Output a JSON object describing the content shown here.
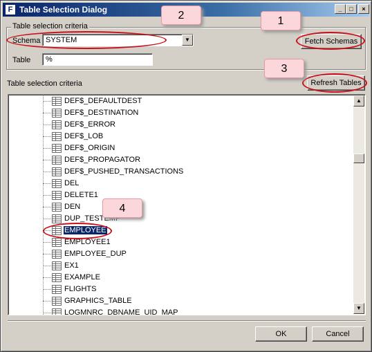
{
  "window": {
    "title": "Table Selection Dialog",
    "icon_letter": "F",
    "controls": {
      "minimize": "_",
      "maximize": "□",
      "close": "×"
    }
  },
  "criteria_group": {
    "legend": "Table selection criteria",
    "schema_label": "Schema",
    "schema_value": "SYSTEM",
    "table_label": "Table",
    "table_value": "%",
    "fetch_button": "Fetch Schemas"
  },
  "tables_section": {
    "label": "Table selection criteria",
    "refresh_button": "Refresh Tables",
    "selected_table": "EMPLOYEE",
    "items": [
      "DEF$_DEFAULTDEST",
      "DEF$_DESTINATION",
      "DEF$_ERROR",
      "DEF$_LOB",
      "DEF$_ORIGIN",
      "DEF$_PROPAGATOR",
      "DEF$_PUSHED_TRANSACTIONS",
      "DEL",
      "DELETE1",
      "DEN",
      "DUP_TESTEMP",
      "EMPLOYEE",
      "EMPLOYEE1",
      "EMPLOYEE_DUP",
      "EX1",
      "EXAMPLE",
      "FLIGHTS",
      "GRAPHICS_TABLE",
      "LOGMNRC_DBNAME_UID_MAP"
    ]
  },
  "footer": {
    "ok_button": "OK",
    "cancel_button": "Cancel"
  },
  "callouts": [
    "1",
    "2",
    "3",
    "4"
  ],
  "colors": {
    "callout_fill": "#fbd7dc",
    "highlight_ellipse": "#c8101b",
    "selection": "#0a246a"
  }
}
